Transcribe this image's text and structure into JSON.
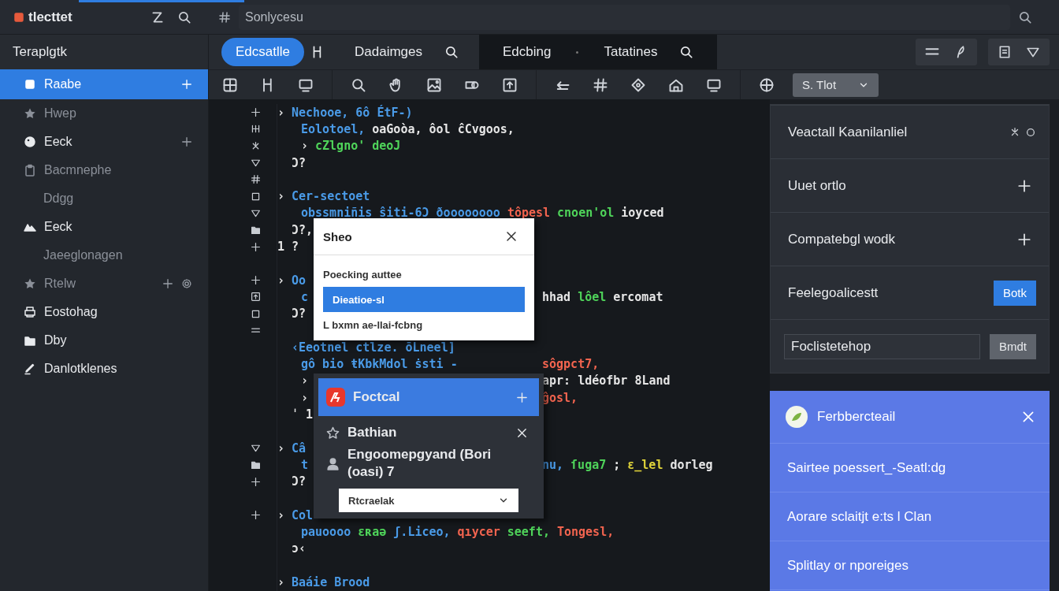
{
  "app": {
    "title": "tlecttet"
  },
  "search": {
    "placeholder": "Sonlycesu"
  },
  "sidebar": {
    "title": "Teraplgtk",
    "items": [
      {
        "label": "Raabe",
        "selected": true,
        "dimmed": false,
        "add": true,
        "settings": false
      },
      {
        "label": "Hwep",
        "selected": false,
        "dimmed": true,
        "add": false,
        "settings": false
      },
      {
        "label": "Eeck",
        "selected": false,
        "dimmed": false,
        "add": true,
        "settings": false
      },
      {
        "label": "Bacmnephe",
        "selected": false,
        "dimmed": true,
        "add": false,
        "settings": false,
        "children": [
          {
            "label": "Ddgg",
            "selected": false,
            "dimmed": true,
            "add": false,
            "settings": false
          }
        ]
      },
      {
        "label": "Eeck",
        "selected": false,
        "dimmed": false,
        "add": false,
        "settings": false,
        "children": [
          {
            "label": "Jaeeglonagen",
            "selected": false,
            "dimmed": true,
            "add": false,
            "settings": false
          }
        ]
      },
      {
        "label": "Rtelw",
        "selected": false,
        "dimmed": true,
        "add": true,
        "settings": true
      },
      {
        "label": "Eostohag",
        "selected": false,
        "dimmed": false,
        "add": false,
        "settings": false
      },
      {
        "label": "Dby",
        "selected": false,
        "dimmed": false,
        "add": false,
        "settings": false
      },
      {
        "label": "Danlotklenes",
        "selected": false,
        "dimmed": false,
        "add": false,
        "settings": false
      }
    ]
  },
  "tabs": [
    {
      "label": "Edcsatlle",
      "kind": "pill",
      "selected": true,
      "search": false
    },
    {
      "label": "Dadaimges",
      "kind": "pill",
      "selected": false,
      "search": true
    },
    {
      "label": "Edcbing",
      "kind": "editor",
      "selected": false,
      "search": false
    },
    {
      "label": "Tatatines",
      "kind": "editor",
      "selected": false,
      "search": true
    }
  ],
  "toolbar": {
    "dropdown": {
      "value": "S. Tlot"
    }
  },
  "editor": {
    "lines": [
      {
        "kind": "head",
        "marker": true,
        "tokens": [
          {
            "text": "›",
            "color": "#e6e6e6"
          },
          {
            "text": "Nechooe, 6ô ÉtF-)",
            "color": "#4a9be8"
          }
        ]
      },
      {
        "kind": "body",
        "marker": true,
        "tokens": [
          {
            "text": "Eolotoel,",
            "color": "#4a9be8"
          },
          {
            "text": "oaGoòa, ôol ĉCvgoos,",
            "color": "#e6e6e6"
          }
        ]
      },
      {
        "kind": "body",
        "marker": true,
        "tokens": [
          {
            "text": "›",
            "color": "#e6e6e6"
          },
          {
            "text": "cZlgno' deoJ",
            "color": "#4fd45a"
          }
        ]
      },
      {
        "kind": "close",
        "marker": true,
        "tokens": [
          {
            "text": "Ɔ?",
            "color": "#e6e6e6"
          }
        ]
      },
      {
        "kind": "blank",
        "marker": true
      },
      {
        "kind": "head",
        "marker": true,
        "tokens": [
          {
            "text": "›",
            "color": "#e6e6e6"
          },
          {
            "text": "Cer-sectoet",
            "color": "#4a9be8"
          }
        ]
      },
      {
        "kind": "body",
        "marker": true,
        "tokens": [
          {
            "text": "obssmniñis ŝiti-6Ɔ ðoooooooo",
            "color": "#4a9be8"
          },
          {
            "text": "tôpesl",
            "color": "#f2644f"
          },
          {
            "text": "cnoen'ol",
            "color": "#4fd45a"
          },
          {
            "text": "ioyced",
            "color": "#e6e6e6"
          }
        ]
      },
      {
        "kind": "close",
        "marker": true,
        "tokens": [
          {
            "text": "Ɔ?,",
            "color": "#e6e6e6"
          }
        ]
      },
      {
        "kind": "head",
        "marker": true,
        "tokens": [
          {
            "text": "1 ?",
            "color": "#e6e6e6"
          }
        ]
      },
      {
        "kind": "blank",
        "marker": false
      },
      {
        "kind": "head",
        "marker": true,
        "tokens": [
          {
            "text": "›",
            "color": "#e6e6e6"
          },
          {
            "text": "Oo",
            "color": "#4a9be8"
          }
        ]
      },
      {
        "kind": "body",
        "marker": true,
        "tokens": [
          {
            "text": "c",
            "color": "#4a9be8"
          }
        ],
        "right": [
          {
            "text": "hhad",
            "color": "#e6e6e6"
          },
          {
            "text": "lôel",
            "color": "#4fd45a"
          },
          {
            "text": "ercomat",
            "color": "#e6e6e6"
          }
        ]
      },
      {
        "kind": "close",
        "marker": true,
        "tokens": [
          {
            "text": "Ɔ?",
            "color": "#e6e6e6"
          }
        ]
      },
      {
        "kind": "blank",
        "marker": true
      },
      {
        "kind": "close",
        "marker": false,
        "tokens": [
          {
            "text": "‹Eeotnel ctlze. ōLneel]",
            "color": "#4a9be8"
          }
        ]
      },
      {
        "kind": "body",
        "marker": false,
        "tokens": [
          {
            "text": "gô bio ŧKbkMdol ṡsti -",
            "color": "#4a9be8"
          }
        ],
        "right": [
          {
            "text": "sôgpct7,",
            "color": "#f2644f"
          }
        ]
      },
      {
        "kind": "body",
        "marker": false,
        "tokens": [
          {
            "text": "›",
            "color": "#e6e6e6"
          }
        ],
        "right": [
          {
            "text": "apr: ldéofbr 8Land",
            "color": "#e6e6e6"
          }
        ]
      },
      {
        "kind": "body",
        "marker": false,
        "tokens": [
          {
            "text": "›",
            "color": "#e6e6e6"
          }
        ],
        "right": [
          {
            "text": "ĝosl,",
            "color": "#f2644f"
          }
        ]
      },
      {
        "kind": "close",
        "marker": false,
        "tokens": [
          {
            "text": "ˈ 1",
            "color": "#e6e6e6"
          }
        ]
      },
      {
        "kind": "blank",
        "marker": false
      },
      {
        "kind": "head",
        "marker": true,
        "tokens": [
          {
            "text": "›",
            "color": "#e6e6e6"
          },
          {
            "text": "Câ",
            "color": "#4a9be8"
          }
        ]
      },
      {
        "kind": "body",
        "marker": true,
        "tokens": [
          {
            "text": "t",
            "color": "#4a9be8"
          }
        ],
        "right": [
          {
            "text": "nu,",
            "color": "#4a9be8"
          },
          {
            "text": "ſuga7",
            "color": "#4fd45a"
          },
          {
            "text": ";",
            "color": "#e6e6e6"
          },
          {
            "text": "ɛ_lel",
            "color": "#e0d43a"
          },
          {
            "text": "dorleg",
            "color": "#e6e6e6"
          }
        ]
      },
      {
        "kind": "close",
        "marker": true,
        "tokens": [
          {
            "text": "Ɔ?",
            "color": "#e6e6e6"
          }
        ]
      },
      {
        "kind": "blank",
        "marker": false
      },
      {
        "kind": "head",
        "marker": true,
        "tokens": [
          {
            "text": "›",
            "color": "#e6e6e6"
          },
          {
            "text": "Col",
            "color": "#4a9be8"
          }
        ]
      },
      {
        "kind": "body",
        "marker": false,
        "tokens": [
          {
            "text": "pauoooo",
            "color": "#4a9be8"
          },
          {
            "text": "ɛʀaə",
            "color": "#4fd45a"
          },
          {
            "text": "ʃ.Liceo,",
            "color": "#4a9be8"
          },
          {
            "text": "qıycer",
            "color": "#f2644f"
          },
          {
            "text": "seeft,",
            "color": "#4fd45a"
          },
          {
            "text": "Tongesl,",
            "color": "#f2644f"
          }
        ]
      },
      {
        "kind": "close",
        "marker": false,
        "tokens": [
          {
            "text": "ɔ‹",
            "color": "#e6e6e6"
          }
        ]
      },
      {
        "kind": "blank",
        "marker": false
      },
      {
        "kind": "head",
        "marker": false,
        "tokens": [
          {
            "text": "›",
            "color": "#e6e6e6"
          },
          {
            "text": "Baáie Brood",
            "color": "#4a9be8"
          }
        ]
      }
    ]
  },
  "popup": {
    "title": "Sheo",
    "items": [
      {
        "label": "Poecking auttee",
        "selected": false
      },
      {
        "label": "Dieatioe-sl",
        "selected": true
      },
      {
        "label": "L bxmn ae-llai-fcbng",
        "selected": false
      }
    ]
  },
  "menu": {
    "items": [
      {
        "label": "Foctcal",
        "selected": true,
        "kind": "add"
      },
      {
        "label": "Bathian",
        "selected": false,
        "kind": "close"
      },
      {
        "label": "Engoomepgyand (Bori (oasi) 7",
        "selected": false,
        "kind": "plain"
      }
    ],
    "select": {
      "value": "Rtcraelak"
    }
  },
  "panel": {
    "title": "Veactall Kaanilanliel",
    "rows": [
      {
        "kind": "add",
        "label": "Uuet ortlo"
      },
      {
        "kind": "add",
        "label": "Compatebgl wodk"
      },
      {
        "kind": "button",
        "label": "Feelegoalicestt",
        "button": "Botk"
      },
      {
        "kind": "input",
        "value": "Foclistetehop",
        "button": "Bmdt"
      }
    ]
  },
  "notice": {
    "title": "Ferbbercteail",
    "items": [
      "Sairtee poessert_-Seatl:dg",
      "Aorare sclaitjt e:ts l Clan",
      "Splitlay or nporeiges"
    ]
  }
}
